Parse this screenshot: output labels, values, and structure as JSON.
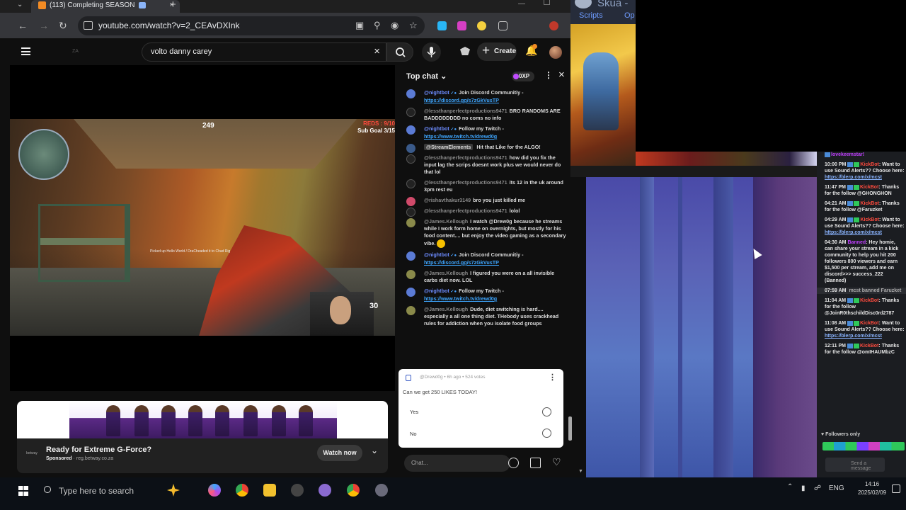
{
  "browser": {
    "tab_title": "(113) Completing SEASON",
    "url": "youtube.com/watch?v=2_CEAvDXInk"
  },
  "youtube": {
    "search_query": "volto danny carey",
    "create_label": "Create",
    "logo_ghost": "ZA"
  },
  "video": {
    "hud_health": "249",
    "hud_reds": "REDS : 9/10",
    "hud_subgoal": "Sub Goal 3/15",
    "hud_ammo": "30",
    "hud_pickup": "Picked up Hello World / DraCheaded it to Chad Rig"
  },
  "ad": {
    "title": "Ready for Extreme G-Force?",
    "sponsored": "Sponsored",
    "domain": "reg.betway.co.za",
    "logo_text": "betway",
    "cta": "Watch now"
  },
  "chat": {
    "mode": "Top chat",
    "xp": "0XP",
    "input_placeholder": "Chat...",
    "messages": [
      {
        "author": "@nightbot",
        "text": "Join Discord Communitiy - ",
        "link": "https://discord.gg/s7zGkVusTP"
      },
      {
        "author": "@lessthanperfectproductions9471",
        "text": "BRO RANDOMS ARE BADDDDDDDD no coms no info",
        "link": ""
      },
      {
        "author": "@nightbot",
        "text": "Follow my Twitch - ",
        "link": "https://www.twitch.tv/drewd0g"
      },
      {
        "author": "@StreamElements",
        "text": "Hit that Like for the ALGO!",
        "link": ""
      },
      {
        "author": "@lessthanperfectproductions9471",
        "text": "how did you fix the input lag the scrips doesnt work plus we would never do that lol",
        "link": ""
      },
      {
        "author": "@lessthanperfectproductions9471",
        "text": "its 12 in the uk around 3pm rest eu",
        "link": ""
      },
      {
        "author": "@rishavthakur3149",
        "text": "bro you just killed me",
        "link": ""
      },
      {
        "author": "@lessthanperfectproductions9471",
        "text": "lolol",
        "link": ""
      },
      {
        "author": "@James.Kellough",
        "text": "I watch @Drew0g because he streams while I work form home on overnights, but mostly for his food content.... but enjoy the video gaming as a secondary vibe.",
        "link": ""
      },
      {
        "author": "@nightbot",
        "text": "Join Discord Communitiy - ",
        "link": "https://discord.gg/s7zGkVusTP"
      },
      {
        "author": "@James.Kellough",
        "text": "I figured you were on a all invisible carbs diet now. LOL",
        "link": ""
      },
      {
        "author": "@nightbot",
        "text": "Follow my Twitch - ",
        "link": "https://www.twitch.tv/drewd0g"
      },
      {
        "author": "@James.Kellough",
        "text": "Dude, diet switching is hard.... especially a all one thing diet. THebody uses crackhead rules for addiction when you isolate food groups",
        "link": ""
      }
    ],
    "poll": {
      "meta": "@Drewd0g • 6h ago • 524 votes",
      "question": "Can we get 250 LIKES TODAY!",
      "options": [
        "Yes",
        "No"
      ]
    }
  },
  "skua": {
    "title": "Skua -",
    "menu": [
      "Scripts",
      "Op"
    ]
  },
  "feed": {
    "top": "lovekeemstar!",
    "items": [
      {
        "time": "10:00 PM",
        "who": "KickBot",
        "text": ": Want to use Sound Alerts?? Choose here: ",
        "link": "https://blerp.com/x/mcst"
      },
      {
        "time": "11:47 PM",
        "who": "KickBot",
        "text": ": Thanks for the follow @GHONGHON",
        "link": ""
      },
      {
        "time": "04:21 AM",
        "who": "KickBot",
        "text": ": Thanks for the follow @Faruzket",
        "link": ""
      },
      {
        "time": "04:29 AM",
        "who": "KickBot",
        "text": ": Want to use Sound Alerts?? Choose here: ",
        "link": "https://blerp.com/x/mcst"
      },
      {
        "time": "04:30 AM",
        "who": "Banned",
        "text": ": Hey homie, can share your stream in a kick community to help you hit 200 followers 800 viewers and earn $1,500 per stream, add me on discord>>> success_222 (Banned)",
        "link": ""
      },
      {
        "time": "07:59 AM",
        "who": "",
        "text": "mcst banned Faruzket",
        "link": ""
      },
      {
        "time": "11:04 AM",
        "who": "KickBot",
        "text": ": Thanks for the follow @JoinR0thschildDisc0rd2787",
        "link": ""
      },
      {
        "time": "11:08 AM",
        "who": "KickBot",
        "text": ": Want to use Sound Alerts?? Choose here: ",
        "link": "https://blerp.com/x/mcst"
      },
      {
        "time": "12:11 PM",
        "who": "KickBot",
        "text": ": Thanks for the follow @omIHAUMbzC",
        "link": ""
      }
    ],
    "followers_only": "Followers only",
    "send_placeholder": "Send a message"
  },
  "taskbar": {
    "search_placeholder": "Type here to search",
    "lang": "ENG",
    "time": "14:16",
    "date": "2025/02/09"
  }
}
